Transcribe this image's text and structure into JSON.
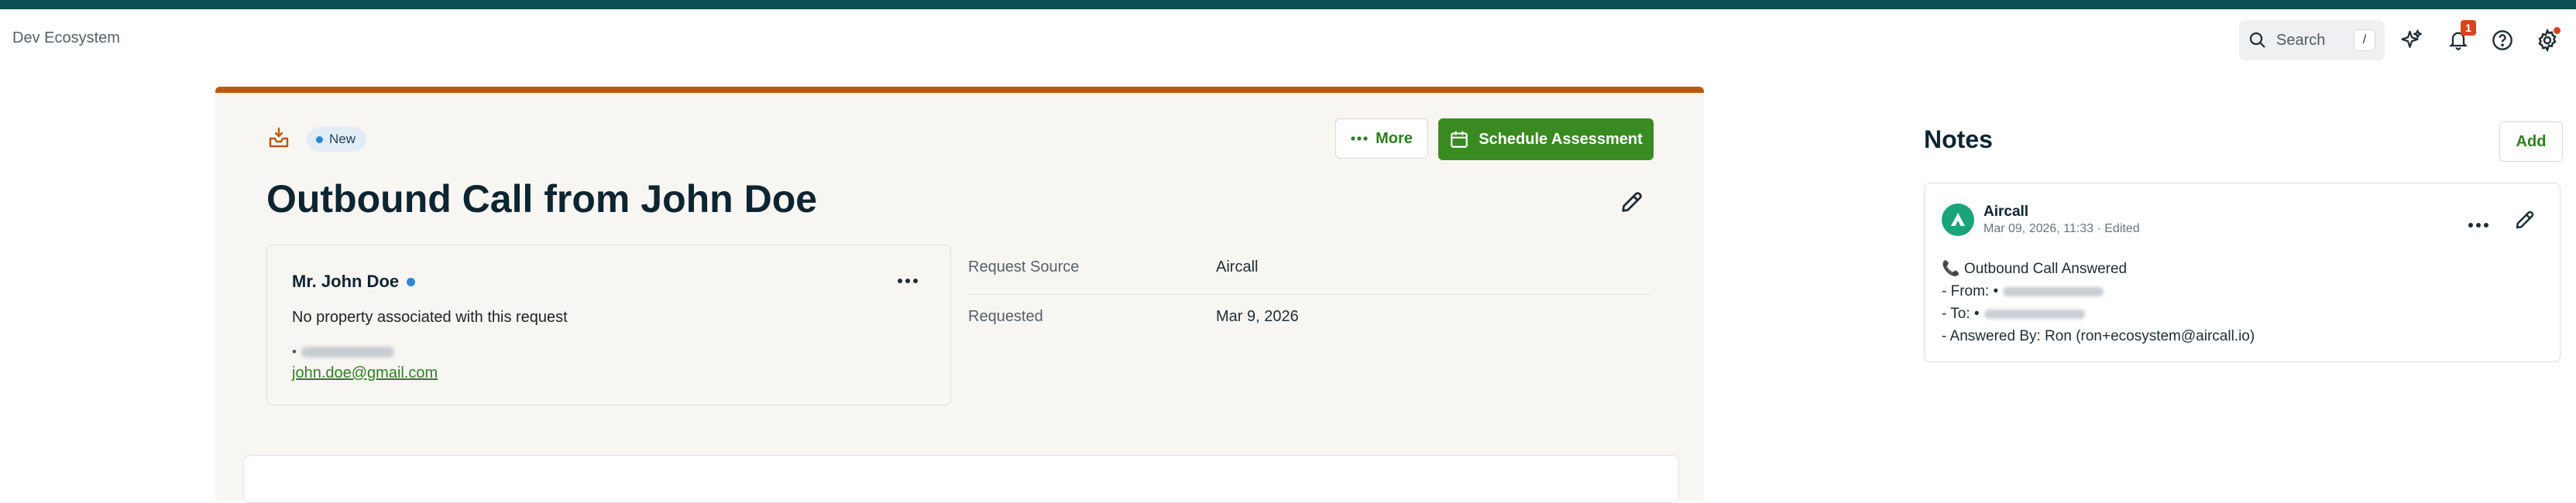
{
  "app": {
    "org_name": "Dev Ecosystem"
  },
  "topbar": {
    "search_placeholder": "Search",
    "search_shortcut": "/",
    "notifications_count": "1"
  },
  "request": {
    "status": "New",
    "title": "Outbound Call from John Doe",
    "more_label": "More",
    "schedule_label": "Schedule Assessment",
    "contact": {
      "name": "Mr. John Doe",
      "no_property": "No property associated with this request",
      "phone_prefix": "•",
      "email": "john.doe@gmail.com"
    },
    "details": [
      {
        "label": "Request Source",
        "value": "Aircall"
      },
      {
        "label": "Requested",
        "value": "Mar 9, 2026"
      }
    ]
  },
  "notes": {
    "title": "Notes",
    "add_label": "Add",
    "items": [
      {
        "author": "Aircall",
        "meta": "Mar 09, 2026, 11:33 · Edited",
        "line1": "📞 Outbound Call Answered",
        "line2": "- From: •",
        "line3": "- To: •",
        "line4": "- Answered By: Ron  (ron+ecosystem@aircall.io)"
      }
    ]
  },
  "colors": {
    "brand_stripe": "#0b4f52",
    "card_accent": "#b85a14",
    "primary_green": "#3a8a22",
    "link_green": "#2e7d1f",
    "badge_red": "#d9431e",
    "avatar_green": "#1aa47a"
  }
}
